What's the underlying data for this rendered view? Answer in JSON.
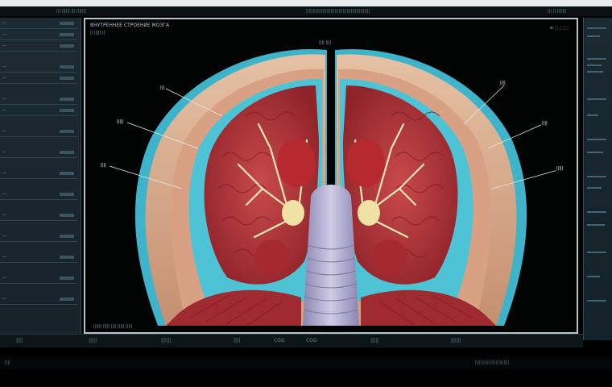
{
  "titlebar": {
    "left": "|||  ||||||  ||| |||||||",
    "center": "|||||||||||||||||||||||||||||||||||||||||||||||",
    "right": "||| || |||||||"
  },
  "viewer": {
    "header_line1": "ВНУТРЕННЕЕ СТРОЕНИЕ МОЗГА",
    "header_line2": "|| ||||| ||",
    "top_right": "≡ ⬚ ⬚ ⬚",
    "center_label": "|||| ||||",
    "labels": {
      "l1": "|||",
      "l2": "|||||",
      "l3": "||||",
      "r1": "||||",
      "r2": "||||",
      "r3": "|||||"
    },
    "footer": "||||||  |||||  ||||  |||||  |||||"
  },
  "bottombar": {
    "c1": "||||",
    "c2": "|||||",
    "c3": "||||||",
    "c4": "||||",
    "c5": "CGG",
    "c6": "CGG",
    "c7": "|||||",
    "c8": "||||||"
  },
  "statusbar": {
    "left": "||||",
    "right": "|||||||||||||||||||||||||"
  },
  "colors": {
    "tissue_red": "#b8333a",
    "csf_cyan": "#4fc3d6",
    "bone": "#e0b79a",
    "brainstem": "#a8a4c9"
  }
}
